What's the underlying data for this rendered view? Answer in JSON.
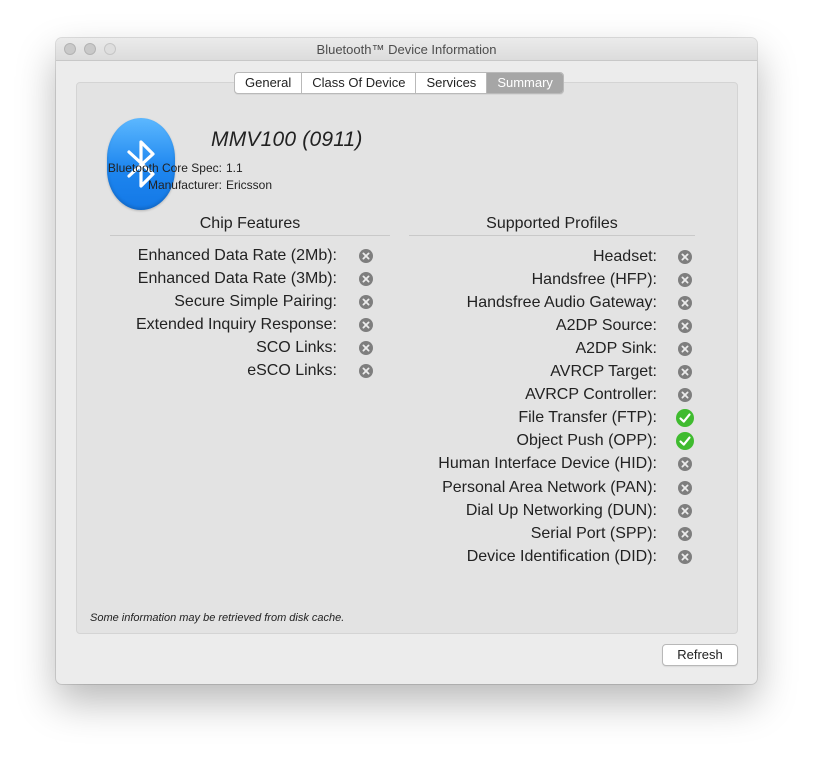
{
  "window": {
    "title": "Bluetooth™ Device Information"
  },
  "tabs": [
    {
      "label": "General",
      "selected": false
    },
    {
      "label": "Class Of Device",
      "selected": false
    },
    {
      "label": "Services",
      "selected": false
    },
    {
      "label": "Summary",
      "selected": true
    }
  ],
  "device": {
    "name": "MMV100  (0911)",
    "core_spec_label": "Bluetooth Core Spec:",
    "core_spec_value": "1.1",
    "manufacturer_label": "Manufacturer:",
    "manufacturer_value": "Ericsson",
    "icon": "bluetooth-icon",
    "icon_color": "#1e86ef"
  },
  "chip_features": {
    "title": "Chip Features",
    "items": [
      {
        "label": "Enhanced Data Rate (2Mb):",
        "supported": false
      },
      {
        "label": "Enhanced Data Rate (3Mb):",
        "supported": false
      },
      {
        "label": "Secure Simple Pairing:",
        "supported": false
      },
      {
        "label": "Extended Inquiry Response:",
        "supported": false
      },
      {
        "label": "SCO Links:",
        "supported": false
      },
      {
        "label": "eSCO Links:",
        "supported": false
      }
    ]
  },
  "profiles": {
    "title": "Supported Profiles",
    "items": [
      {
        "label": "Headset:",
        "supported": false
      },
      {
        "label": "Handsfree (HFP):",
        "supported": false
      },
      {
        "label": "Handsfree Audio Gateway:",
        "supported": false
      },
      {
        "label": "A2DP Source:",
        "supported": false
      },
      {
        "label": "A2DP Sink:",
        "supported": false
      },
      {
        "label": "AVRCP Target:",
        "supported": false
      },
      {
        "label": "AVRCP Controller:",
        "supported": false
      },
      {
        "label": "File Transfer (FTP):",
        "supported": true
      },
      {
        "label": "Object Push (OPP):",
        "supported": true
      },
      {
        "label": "Human Interface Device (HID):",
        "supported": false
      },
      {
        "label": "Personal Area Network (PAN):",
        "supported": false
      },
      {
        "label": "Dial Up Networking (DUN):",
        "supported": false
      },
      {
        "label": "Serial Port (SPP):",
        "supported": false
      },
      {
        "label": "Device Identification (DID):",
        "supported": false
      }
    ]
  },
  "status_icons": {
    "supported": "checkmark-icon",
    "unsupported": "x-circle-icon",
    "supported_color": "#3fbb2f",
    "unsupported_color": "#7e7e7e"
  },
  "footnote": "Some information may be retrieved from disk cache.",
  "buttons": {
    "refresh": "Refresh"
  }
}
